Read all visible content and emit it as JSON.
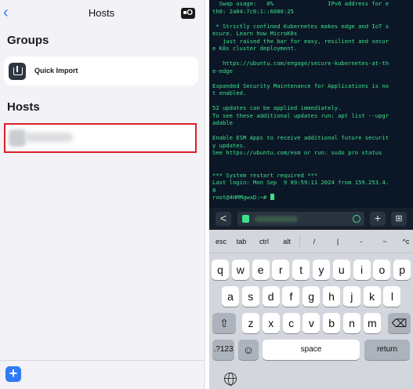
{
  "left_panel": {
    "nav": {
      "title": "Hosts",
      "back_icon": "chevron-left-icon",
      "right_icon": "sftp-icon"
    },
    "groups_heading": "Groups",
    "quick_import": {
      "label": "Quick Import",
      "icon": "import-icon"
    },
    "hosts_heading": "Hosts",
    "bottom": {
      "add_label": "+"
    }
  },
  "terminal": {
    "lines": [
      "  Swap usage:   0%                IPv6 address for e",
      "th0: 2a04:7c0:1::6080:25",
      "",
      " * Strictly confined Kubernetes makes edge and IoT s",
      "ecure. Learn how MicroK8s",
      "   just raised the bar for easy, resilient and secur",
      "e K8s cluster deployment.",
      "",
      "   https://ubuntu.com/engage/secure-kubernetes-at-th",
      "e-edge",
      "",
      "Expanded Security Maintenance for Applications is no",
      "t enabled.",
      "",
      "52 updates can be applied immediately.",
      "To see these additional updates run: apt list --upgr",
      "adable",
      "",
      "Enable ESM Apps to receive additional future securit",
      "y updates.",
      "See https://ubuntu.com/esm or run: sudo pro status",
      "",
      "",
      "*** System restart required ***",
      "Last login: Mon Sep  9 09:59:11 2024 from 159.253.4.",
      "8"
    ],
    "prompt": "root@4HMMgwxD:~# "
  },
  "toolbar": {
    "back": "<",
    "plus": "+",
    "grid": "⊞"
  },
  "extra_keys": [
    "esc",
    "tab",
    "ctrl",
    "alt",
    "/",
    "|",
    "-",
    "~",
    "^c"
  ],
  "keyboard": {
    "row1": [
      "q",
      "w",
      "e",
      "r",
      "t",
      "y",
      "u",
      "i",
      "o",
      "p"
    ],
    "row2": [
      "a",
      "s",
      "d",
      "f",
      "g",
      "h",
      "j",
      "k",
      "l"
    ],
    "row3": [
      "z",
      "x",
      "c",
      "v",
      "b",
      "n",
      "m"
    ],
    "shift": "⇧",
    "backspace": "⌫",
    "numbers": ".?123",
    "emoji": "☺",
    "space": "space",
    "return": "return"
  }
}
